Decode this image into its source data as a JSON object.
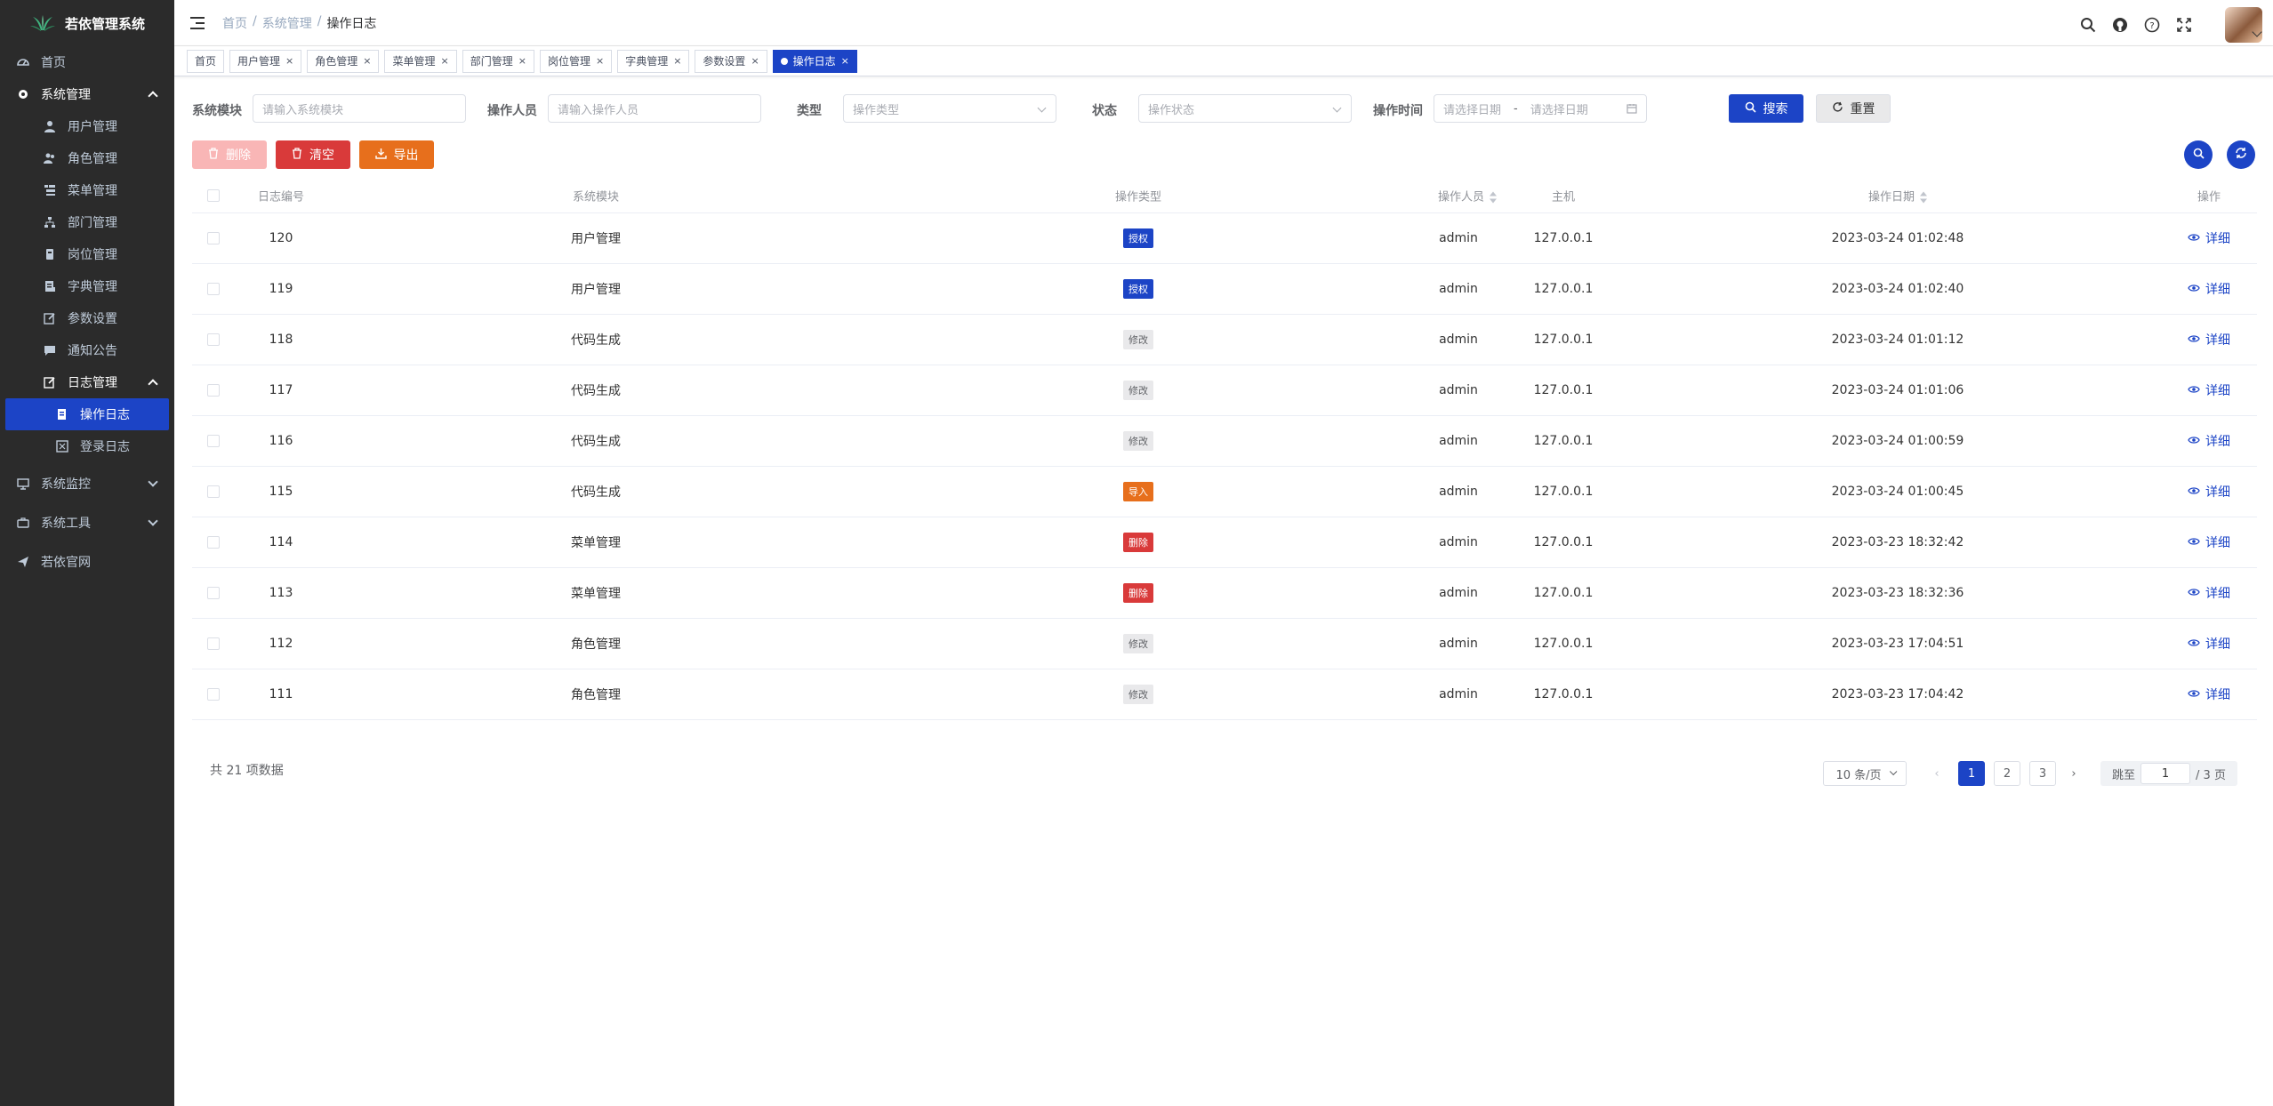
{
  "app": {
    "title": "若依管理系统"
  },
  "sidebar": {
    "items": [
      {
        "label": "首页",
        "icon": "dashboard-icon"
      },
      {
        "label": "系统管理",
        "icon": "gear-icon",
        "expanded": true,
        "children": [
          {
            "label": "用户管理",
            "icon": "user-icon"
          },
          {
            "label": "角色管理",
            "icon": "peoples-icon"
          },
          {
            "label": "菜单管理",
            "icon": "tree-table-icon"
          },
          {
            "label": "部门管理",
            "icon": "tree-icon"
          },
          {
            "label": "岗位管理",
            "icon": "post-icon"
          },
          {
            "label": "字典管理",
            "icon": "dict-icon"
          },
          {
            "label": "参数设置",
            "icon": "edit-icon"
          },
          {
            "label": "通知公告",
            "icon": "message-icon"
          },
          {
            "label": "日志管理",
            "icon": "log-icon",
            "expanded": true,
            "children": [
              {
                "label": "操作日志",
                "icon": "form-icon",
                "active": true
              },
              {
                "label": "登录日志",
                "icon": "logininfor-icon"
              }
            ]
          }
        ]
      },
      {
        "label": "系统监控",
        "icon": "monitor-icon"
      },
      {
        "label": "系统工具",
        "icon": "tool-icon"
      },
      {
        "label": "若依官网",
        "icon": "guide-icon"
      }
    ]
  },
  "breadcrumb": [
    "首页",
    "系统管理",
    "操作日志"
  ],
  "tags": [
    "首页",
    "用户管理",
    "角色管理",
    "菜单管理",
    "部门管理",
    "岗位管理",
    "字典管理",
    "参数设置",
    "操作日志"
  ],
  "active_tag": "操作日志",
  "search": {
    "module_label": "系统模块",
    "module_placeholder": "请输入系统模块",
    "operator_label": "操作人员",
    "operator_placeholder": "请输入操作人员",
    "type_label": "类型",
    "type_placeholder": "操作类型",
    "status_label": "状态",
    "status_placeholder": "操作状态",
    "time_label": "操作时间",
    "start_placeholder": "请选择日期",
    "range_sep": "-",
    "end_placeholder": "请选择日期",
    "search_btn": "搜索",
    "reset_btn": "重置"
  },
  "toolbar": {
    "delete_btn": "删除",
    "clean_btn": "清空",
    "export_btn": "导出"
  },
  "table": {
    "headers": [
      "日志编号",
      "系统模块",
      "操作类型",
      "操作人员",
      "主机",
      "操作日期",
      "操作"
    ],
    "rows": [
      {
        "id": "120",
        "module": "用户管理",
        "type": "授权",
        "type_style": "primary",
        "operator": "admin",
        "host": "127.0.0.1",
        "date": "2023-03-24 01:02:48",
        "action": "详细"
      },
      {
        "id": "119",
        "module": "用户管理",
        "type": "授权",
        "type_style": "primary",
        "operator": "admin",
        "host": "127.0.0.1",
        "date": "2023-03-24 01:02:40",
        "action": "详细"
      },
      {
        "id": "118",
        "module": "代码生成",
        "type": "修改",
        "type_style": "info",
        "operator": "admin",
        "host": "127.0.0.1",
        "date": "2023-03-24 01:01:12",
        "action": "详细"
      },
      {
        "id": "117",
        "module": "代码生成",
        "type": "修改",
        "type_style": "info",
        "operator": "admin",
        "host": "127.0.0.1",
        "date": "2023-03-24 01:01:06",
        "action": "详细"
      },
      {
        "id": "116",
        "module": "代码生成",
        "type": "修改",
        "type_style": "info",
        "operator": "admin",
        "host": "127.0.0.1",
        "date": "2023-03-24 01:00:59",
        "action": "详细"
      },
      {
        "id": "115",
        "module": "代码生成",
        "type": "导入",
        "type_style": "warning",
        "operator": "admin",
        "host": "127.0.0.1",
        "date": "2023-03-24 01:00:45",
        "action": "详细"
      },
      {
        "id": "114",
        "module": "菜单管理",
        "type": "删除",
        "type_style": "danger",
        "operator": "admin",
        "host": "127.0.0.1",
        "date": "2023-03-23 18:32:42",
        "action": "详细"
      },
      {
        "id": "113",
        "module": "菜单管理",
        "type": "删除",
        "type_style": "danger",
        "operator": "admin",
        "host": "127.0.0.1",
        "date": "2023-03-23 18:32:36",
        "action": "详细"
      },
      {
        "id": "112",
        "module": "角色管理",
        "type": "修改",
        "type_style": "info",
        "operator": "admin",
        "host": "127.0.0.1",
        "date": "2023-03-23 17:04:51",
        "action": "详细"
      },
      {
        "id": "111",
        "module": "角色管理",
        "type": "修改",
        "type_style": "info",
        "operator": "admin",
        "host": "127.0.0.1",
        "date": "2023-03-23 17:04:42",
        "action": "详细"
      }
    ]
  },
  "pagination": {
    "total_text": "共 21 项数据",
    "page_size": "10 条/页",
    "pages": [
      "1",
      "2",
      "3"
    ],
    "current": "1",
    "jump_label": "跳至",
    "jump_value": "1",
    "total_pages_text": "/ 3 页"
  },
  "colors": {
    "primary": "#1c44c6",
    "danger": "#d93a3a",
    "warning": "#e76f1c",
    "info_bg": "#e9e9eb",
    "sidebar_bg": "#2b2b2b"
  }
}
